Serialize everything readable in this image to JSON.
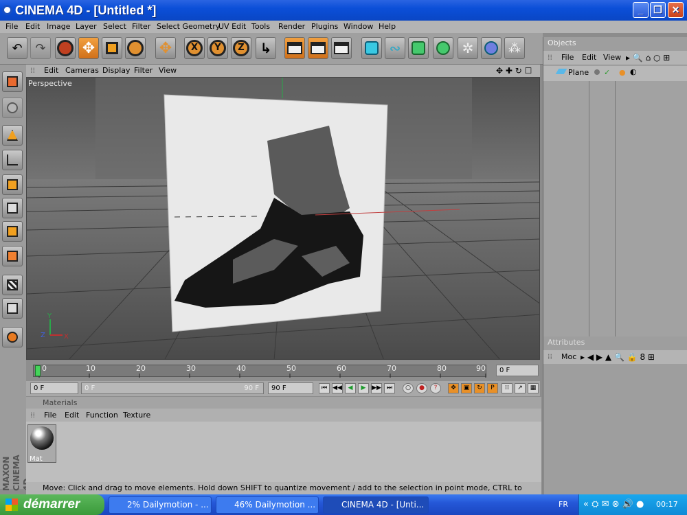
{
  "window": {
    "title": "CINEMA 4D - [Untitled *]"
  },
  "menu": [
    "File",
    "Edit",
    "Image",
    "Layer",
    "Select",
    "Filter",
    "Select Geometry",
    "UV Edit",
    "Tools",
    "Render",
    "Plugins",
    "Window",
    "Help"
  ],
  "viewport": {
    "menu": [
      "Edit",
      "Cameras",
      "Display",
      "Filter",
      "View"
    ],
    "label": "Perspective",
    "axis": {
      "x": "X",
      "y": "Y",
      "z": "Z"
    }
  },
  "timeline": {
    "ticks": [
      "0",
      "10",
      "20",
      "30",
      "40",
      "50",
      "60",
      "70",
      "80",
      "90"
    ],
    "current_frame": "0 F",
    "start_field": "0 F",
    "range_start": "0 F",
    "range_end": "90 F",
    "end_field": "90 F"
  },
  "materials": {
    "title": "Materials",
    "menu": [
      "File",
      "Edit",
      "Function",
      "Texture"
    ],
    "items": [
      {
        "label": "Mat"
      }
    ]
  },
  "objects": {
    "title": "Objects",
    "menu": [
      "File",
      "Edit",
      "View"
    ],
    "items": [
      {
        "name": "Plane"
      }
    ]
  },
  "attributes": {
    "title": "Attributes",
    "menu": [
      "Moc"
    ]
  },
  "status": {
    "text": "Move: Click and drag to move elements. Hold down SHIFT to quantize movement / add to the selection in point mode, CTRL to remove."
  },
  "branding": {
    "logo_text": "MAXON CINEMA 4D"
  },
  "taskbar": {
    "start_label": "démarrer",
    "tasks": [
      {
        "label": "2% Dailymotion - ..."
      },
      {
        "label": "46% Dailymotion ..."
      },
      {
        "label": "CINEMA 4D - [Unti..."
      }
    ],
    "lang": "FR",
    "clock": "00:17"
  },
  "icons": {
    "toolbar": [
      "undo-icon",
      "redo-icon",
      "live-select-icon",
      "move-icon",
      "scale-icon",
      "rotate-icon",
      "move-icon",
      "x-axis-icon",
      "y-axis-icon",
      "z-axis-icon",
      "coordinate-system-icon",
      "render-view-icon",
      "render-picture-viewer-icon",
      "render-settings-icon",
      "cube-icon",
      "spline-icon",
      "nurbs-icon",
      "array-icon",
      "deformer-icon",
      "scene-icon",
      "light-icon"
    ],
    "left": [
      "viewport-layout-icon",
      "camera-icon",
      "use-model-mode-icon",
      "use-object-axis-icon",
      "use-points-icon",
      "use-edges-icon",
      "use-polygons-icon",
      "texture-mode-icon",
      "tweak-mode-icon",
      "sculpt-icon"
    ]
  },
  "colors": {
    "accent": "#e89028",
    "titlebar": "#0b4fd8",
    "timeline_marker": "#45d45a"
  }
}
